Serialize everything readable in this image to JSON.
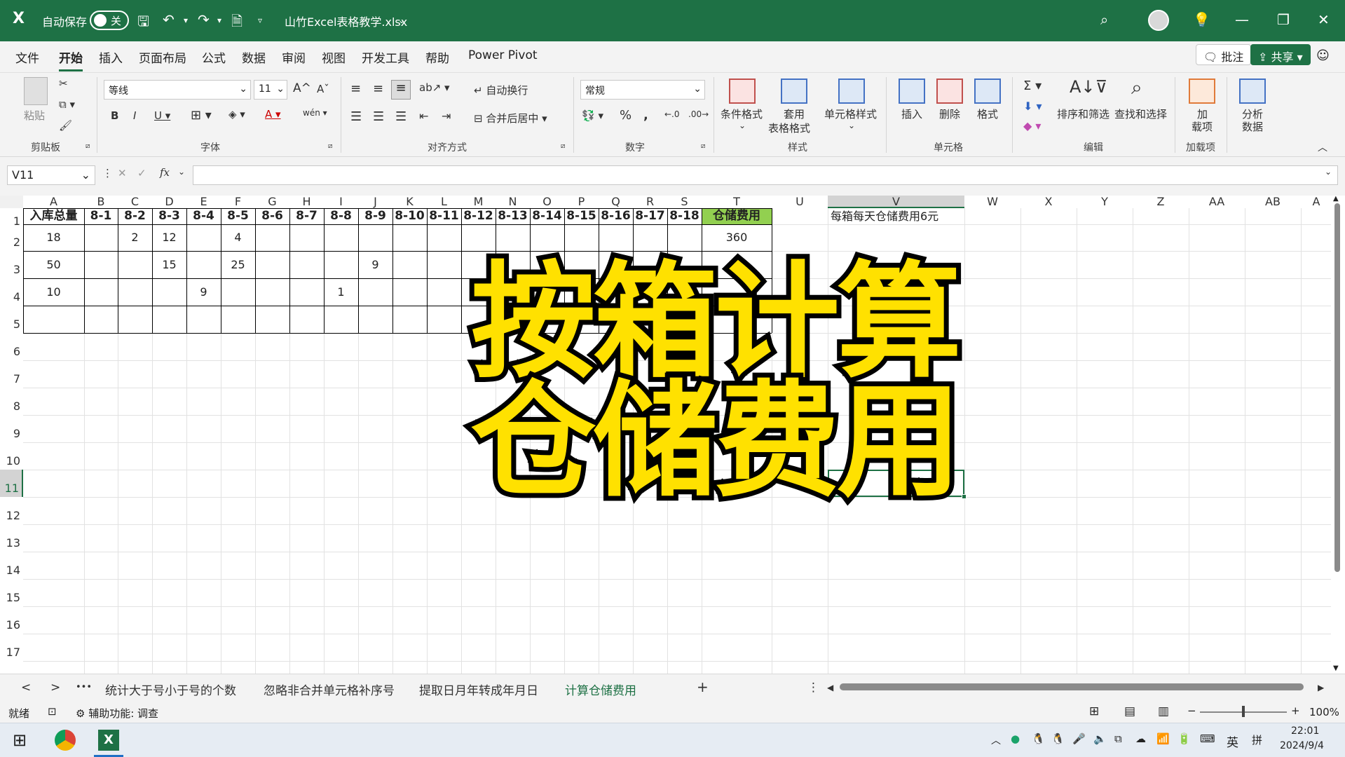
{
  "titlebar": {
    "autosave_label": "自动保存",
    "autosave_state": "关",
    "filename": "山竹Excel表格教学.xlsx",
    "accent": "#1e7145"
  },
  "menu": {
    "items": [
      "文件",
      "开始",
      "插入",
      "页面布局",
      "公式",
      "数据",
      "审阅",
      "视图",
      "开发工具",
      "帮助",
      "Power Pivot"
    ],
    "active": "开始",
    "comment_btn": "批注",
    "share_btn": "共享"
  },
  "ribbon": {
    "groups": {
      "clipboard": "剪贴板",
      "font": "字体",
      "align": "对齐方式",
      "number": "数字",
      "styles": "样式",
      "cells": "单元格",
      "editing": "编辑",
      "addins": "加载项"
    },
    "paste": "粘贴",
    "font_name": "等线",
    "font_size": "11",
    "wrap_text": "自动换行",
    "merge_center": "合并后居中",
    "number_format": "常规",
    "cond_format": "条件格式",
    "table_format_1": "套用",
    "table_format_2": "表格格式",
    "cell_style": "单元格样式",
    "insert": "插入",
    "delete": "删除",
    "format": "格式",
    "sort_filter": "排序和筛选",
    "find_select": "查找和选择",
    "addins_1": "加",
    "addins_2": "载项",
    "analyze_1": "分析",
    "analyze_2": "数据"
  },
  "formula_bar": {
    "name_box": "V11",
    "fx": "fx",
    "value": ""
  },
  "grid": {
    "columns": [
      "A",
      "B",
      "C",
      "D",
      "E",
      "F",
      "G",
      "H",
      "I",
      "J",
      "K",
      "L",
      "M",
      "N",
      "O",
      "P",
      "Q",
      "R",
      "S",
      "T",
      "U",
      "V",
      "W",
      "X",
      "Y",
      "Z",
      "AA",
      "AB",
      "A"
    ],
    "rows": [
      "1",
      "2",
      "3",
      "4",
      "5",
      "6",
      "7",
      "8",
      "9",
      "10",
      "11",
      "12",
      "13",
      "14",
      "15",
      "16",
      "17"
    ],
    "header_row": [
      "入库总量",
      "8-1",
      "8-2",
      "8-3",
      "8-4",
      "8-5",
      "8-6",
      "8-7",
      "8-8",
      "8-9",
      "8-10",
      "8-11",
      "8-12",
      "8-13",
      "8-14",
      "8-15",
      "8-16",
      "8-17",
      "8-18",
      "仓储费用"
    ],
    "data_rows": [
      {
        "A": "18",
        "C": "2",
        "D": "12",
        "F": "4",
        "T": "360"
      },
      {
        "A": "50",
        "D": "15",
        "F": "25",
        "J": "9"
      },
      {
        "A": "10",
        "E": "9",
        "I": "1"
      }
    ],
    "note": "每箱每天仓储费用6元",
    "highlight_color": "#92d050",
    "selected_cell": "V11"
  },
  "overlay": {
    "line1": "按箱计算",
    "line2": "仓储费用"
  },
  "sheet_tabs": {
    "items": [
      "统计大于号小于号的个数",
      "忽略非合并单元格补序号",
      "提取日月年转成年月日",
      "计算仓储费用"
    ],
    "active": "计算仓储费用",
    "more": "•••",
    "add": "+"
  },
  "status": {
    "ready": "就绪",
    "accessibility": "辅助功能: 调查",
    "zoom": "100%"
  },
  "taskbar": {
    "ime": "英",
    "ime2": "拼",
    "time": "22:01",
    "date": "2024/9/4"
  }
}
